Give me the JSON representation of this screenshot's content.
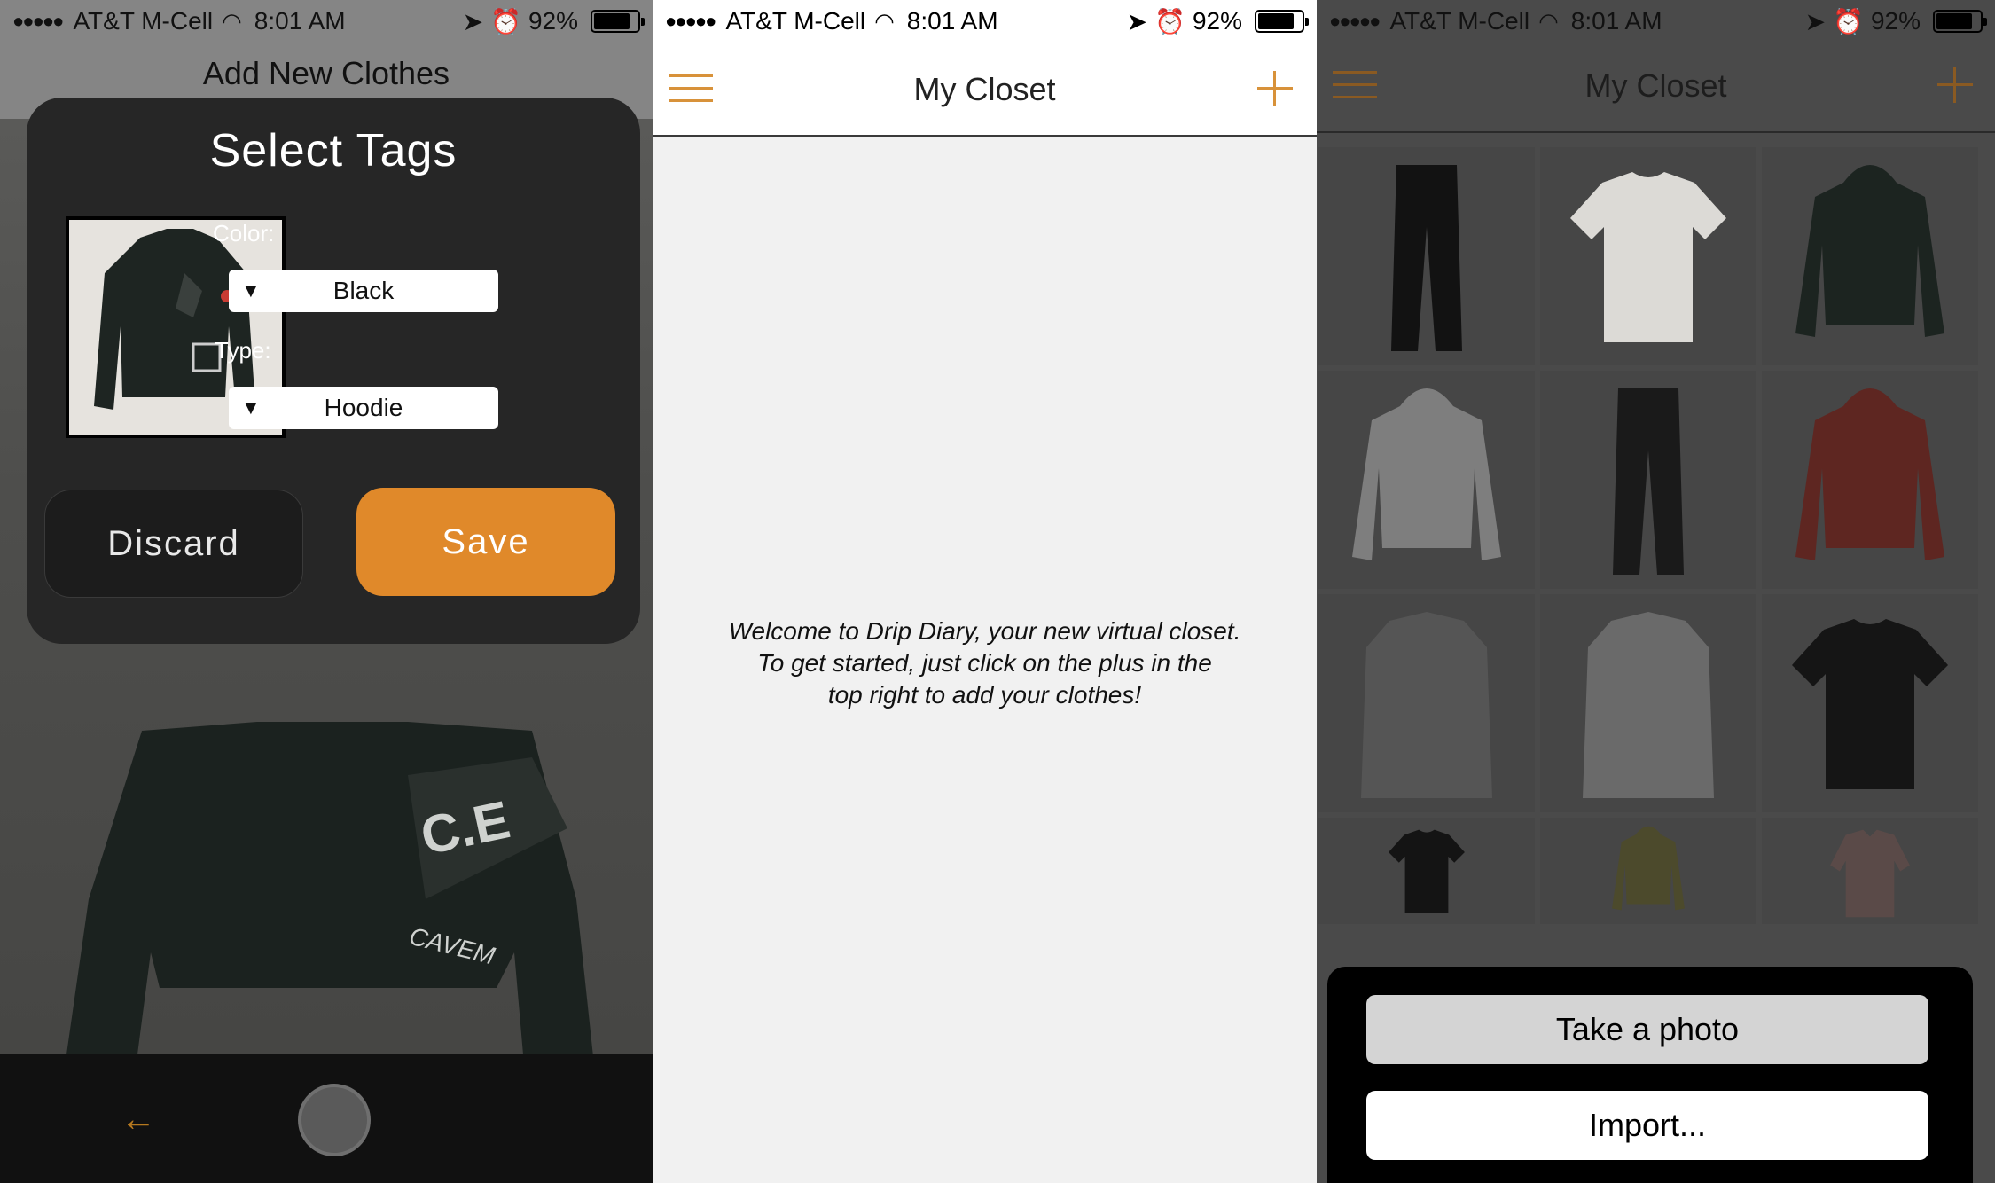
{
  "status": {
    "signal": "●●●●●",
    "carrier": "AT&T M-Cell",
    "time": "8:01 AM",
    "battery": "92%"
  },
  "screen_add": {
    "title": "Add New Clothes",
    "modal_title": "Select Tags",
    "color_label": "Color:",
    "color_value": "Black",
    "type_label": "Type:",
    "type_value": "Hoodie",
    "dropdown_arrow": "▼",
    "discard_label": "Discard",
    "save_label": "Save",
    "back_arrow": "←"
  },
  "screen_empty": {
    "title": "My Closet",
    "welcome_line1": "Welcome to Drip Diary, your new virtual closet.",
    "welcome_line2": "To get started, just click on the plus in the",
    "welcome_line3": "top right to add your clothes!"
  },
  "screen_closet": {
    "title": "My Closet",
    "items": [
      {
        "name": "black-jeans",
        "color": "#121212"
      },
      {
        "name": "white-tee",
        "color": "#dcdad6"
      },
      {
        "name": "black-distressed-hoodie",
        "color": "#1c2420"
      },
      {
        "name": "grey-hoodie",
        "color": "#7e7e7e"
      },
      {
        "name": "black-cargo-pants",
        "color": "#1a1a1a"
      },
      {
        "name": "burgundy-turtleneck",
        "color": "#5e2621"
      },
      {
        "name": "grey-bleached-jacket",
        "color": "#555"
      },
      {
        "name": "gradient-coat",
        "color": "#6a6a6a"
      },
      {
        "name": "black-graphic-tee",
        "color": "#151515"
      },
      {
        "name": "black-print-tee",
        "color": "#141414"
      },
      {
        "name": "olive-hoodie",
        "color": "#4c4a2c"
      },
      {
        "name": "plaid-shirt",
        "color": "#5a4a48"
      }
    ],
    "take_photo_label": "Take a photo",
    "import_label": "Import..."
  },
  "colors": {
    "accent": "#e0892a",
    "accent_icon": "#d8923a"
  }
}
